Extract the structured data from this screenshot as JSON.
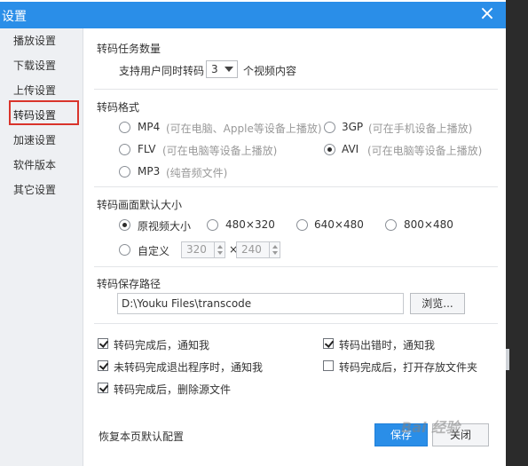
{
  "window": {
    "title": "设置",
    "close_symbol": "×"
  },
  "sidebar": {
    "items": [
      {
        "label": "播放设置"
      },
      {
        "label": "下载设置"
      },
      {
        "label": "上传设置"
      },
      {
        "label": "转码设置"
      },
      {
        "label": "加速设置"
      },
      {
        "label": "软件版本"
      },
      {
        "label": "其它设置"
      }
    ],
    "selected_index": 3
  },
  "tasks": {
    "title": "转码任务数量",
    "prefix": "支持用户同时转码",
    "count_value": "3",
    "suffix": "个视频内容"
  },
  "format": {
    "title": "转码格式",
    "options": [
      {
        "name": "MP4",
        "desc": "(可在电脑、Apple等设备上播放)",
        "checked": false
      },
      {
        "name": "3GP",
        "desc": "(可在手机设备上播放)",
        "checked": false
      },
      {
        "name": "FLV",
        "desc": "(可在电脑等设备上播放)",
        "checked": false
      },
      {
        "name": "AVI",
        "desc": "(可在电脑等设备上播放)",
        "checked": true
      },
      {
        "name": "MP3",
        "desc": "(纯音频文件)",
        "checked": false
      }
    ]
  },
  "size": {
    "title": "转码画面默认大小",
    "options": [
      {
        "label": "原视频大小",
        "checked": true
      },
      {
        "label": "480×320",
        "checked": false
      },
      {
        "label": "640×480",
        "checked": false
      },
      {
        "label": "800×480",
        "checked": false
      },
      {
        "label": "自定义",
        "checked": false
      }
    ],
    "custom_width": "320",
    "custom_height": "240",
    "times": "×"
  },
  "path": {
    "title": "转码保存路径",
    "value": "D:\\Youku Files\\transcode",
    "browse_label": "浏览..."
  },
  "notify": {
    "options": [
      {
        "label": "转码完成后，通知我",
        "checked": true
      },
      {
        "label": "转码出错时，通知我",
        "checked": true
      },
      {
        "label": "未转码完成退出程序时，通知我",
        "checked": true
      },
      {
        "label": "转码完成后，打开存放文件夹",
        "checked": false
      },
      {
        "label": "转码完成后，删除源文件",
        "checked": true
      }
    ]
  },
  "footer": {
    "restore_label": "恢复本页默认配置",
    "save_label": "保存",
    "close_label": "关闭"
  },
  "watermark_text": "Bai 经验",
  "colors": {
    "accent": "#2a8ee8",
    "highlight": "#d9342b"
  }
}
